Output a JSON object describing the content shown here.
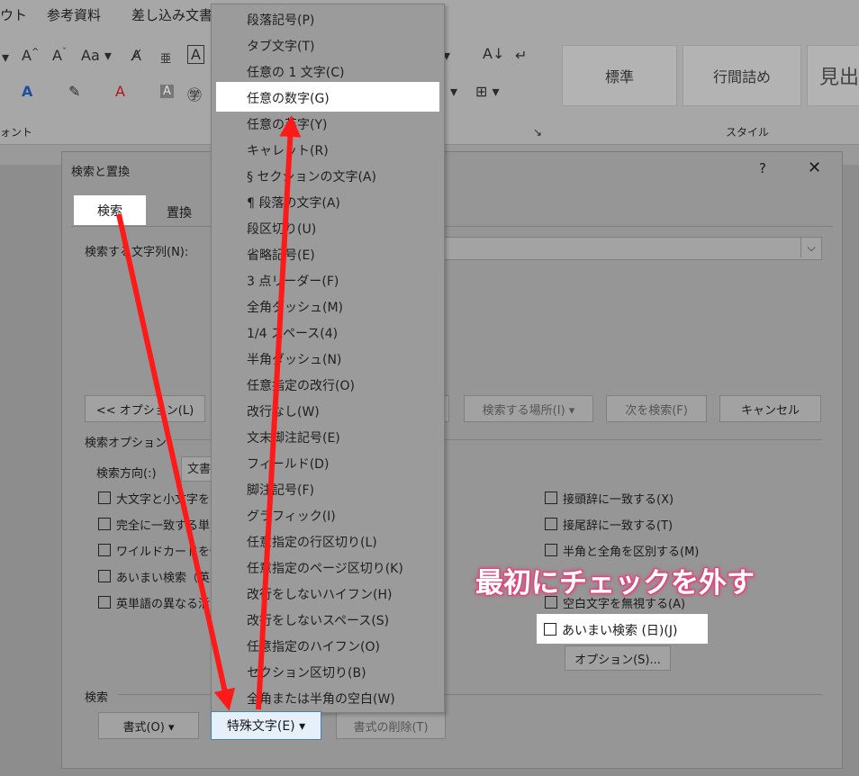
{
  "ribbon": {
    "tabs": [
      "ウト",
      "参考資料",
      "差し込み文書"
    ],
    "group_font": "ォント",
    "group_style": "スタイル",
    "styles": [
      "標準",
      "行間詰め",
      "見出"
    ]
  },
  "dialog": {
    "title": "検索と置換",
    "help": "?",
    "close": "✕",
    "tabs": {
      "find": "検索",
      "replace": "置換"
    },
    "find_label": "検索する文字列(N):",
    "buttons": {
      "options": "<< オプション(L)",
      "search_in": "検索する場所(I) ▾",
      "find_next": "次を検索(F)",
      "cancel": "キャンセル",
      "format": "書式(O) ▾",
      "special": "特殊文字(E) ▾",
      "clear_format": "書式の削除(T)",
      "options_s": "オプション(S)..."
    },
    "search_options_label": "検索オプション",
    "direction_label": "検索方向(:)",
    "direction_value": "文書",
    "left_options": [
      "大文字と小文字を",
      "完全に一致する単",
      "ワイルドカードを使",
      "あいまい検索（英",
      "英単語の異なる活"
    ],
    "right_options": [
      "接頭辞に一致する(X)",
      "接尾辞に一致する(T)",
      "半角と全角を区別する(M)",
      "空白文字を無視する(A)",
      "あいまい検索 (日)(J)"
    ],
    "search_section": "検索"
  },
  "menu": {
    "items": [
      "段落記号(P)",
      "タブ文字(T)",
      "任意の 1 文字(C)",
      "任意の数字(G)",
      "任意の英字(Y)",
      "キャレット(R)",
      "§ セクションの文字(A)",
      "¶ 段落の文字(A)",
      "段区切り(U)",
      "省略記号(E)",
      "3 点リーダー(F)",
      "全角ダッシュ(M)",
      "1/4 スペース(4)",
      "半角ダッシュ(N)",
      "任意指定の改行(O)",
      "改行なし(W)",
      "文末脚注記号(E)",
      "フィールド(D)",
      "脚注記号(F)",
      "グラフィック(I)",
      "任意指定の行区切り(L)",
      "任意指定のページ区切り(K)",
      "改行をしないハイフン(H)",
      "改行をしないスペース(S)",
      "任意指定のハイフン(O)",
      "セクション区切り(B)",
      "全角または半角の空白(W)"
    ],
    "highlighted_index": 3
  },
  "annotation": "最初にチェックを外す",
  "colors": {
    "arrow": "#ff1a1a",
    "annotation_glow": "#e0437a",
    "dim": "#969696"
  }
}
